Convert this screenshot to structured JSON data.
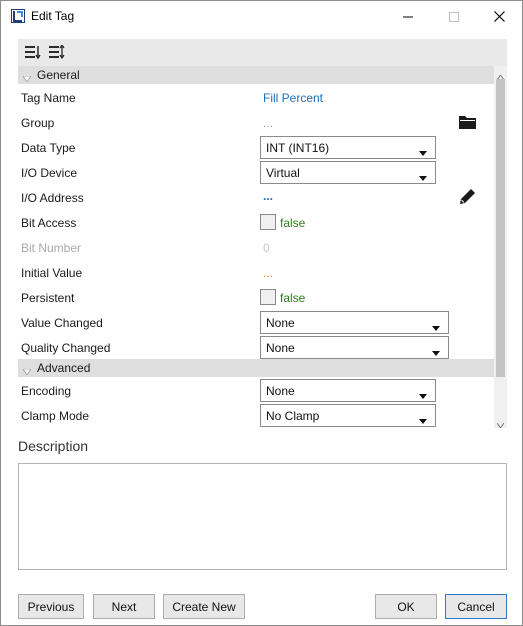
{
  "window": {
    "title": "Edit Tag"
  },
  "toolbar": {
    "sort_categorized_icon": "sort-categorized-icon",
    "sort_alpha_icon": "sort-alpha-icon"
  },
  "categories": {
    "general": "General",
    "advanced": "Advanced"
  },
  "props": {
    "tag_name": {
      "label": "Tag Name",
      "value": "Fill Percent"
    },
    "group": {
      "label": "Group",
      "value": "..."
    },
    "data_type": {
      "label": "Data Type",
      "value": "INT (INT16)"
    },
    "io_device": {
      "label": "I/O Device",
      "value": "Virtual"
    },
    "io_address": {
      "label": "I/O Address",
      "value": "..."
    },
    "bit_access": {
      "label": "Bit Access",
      "value": "false"
    },
    "bit_number": {
      "label": "Bit Number",
      "value": "0"
    },
    "initial_value": {
      "label": "Initial Value",
      "value": "..."
    },
    "persistent": {
      "label": "Persistent",
      "value": "false"
    },
    "value_changed": {
      "label": "Value Changed",
      "value": "None"
    },
    "quality_changed": {
      "label": "Quality Changed",
      "value": "None"
    },
    "encoding": {
      "label": "Encoding",
      "value": "None"
    },
    "clamp_mode": {
      "label": "Clamp Mode",
      "value": "No Clamp"
    }
  },
  "description": {
    "label": "Description",
    "value": ""
  },
  "buttons": {
    "previous": "Previous",
    "next": "Next",
    "create_new": "Create New",
    "ok": "OK",
    "cancel": "Cancel"
  },
  "colors": {
    "link": "#1e6fb8",
    "bool_false": "#2e7d1f",
    "dots_orange": "#d97b12",
    "accent_border": "#2a78d0"
  }
}
